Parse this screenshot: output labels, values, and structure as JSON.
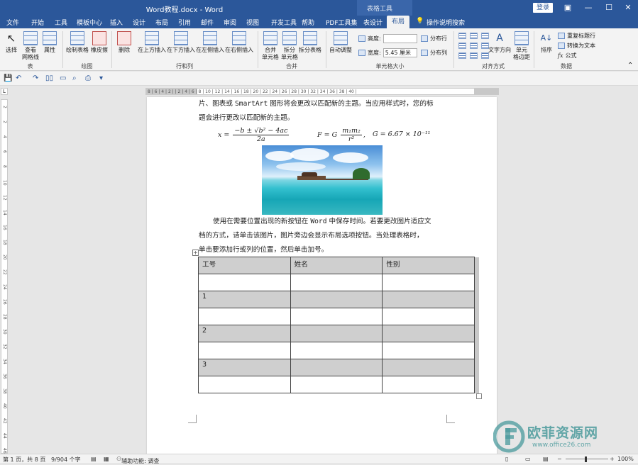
{
  "titlebar": {
    "doc_title": "Word教程.docx - Word",
    "context_label": "表格工具",
    "login": "登录"
  },
  "tabs": [
    "文件",
    "开始",
    "工具",
    "模板中心",
    "插入",
    "设计",
    "布局",
    "引用",
    "邮件",
    "审阅",
    "视图",
    "开发工具",
    "帮助",
    "PDF工具集",
    "表设计",
    "布局"
  ],
  "tell_me": "操作说明搜索",
  "ribbon": {
    "groups": {
      "table": "表",
      "draw": "绘图",
      "rows_cols": "行和列",
      "merge": "合并",
      "cell_size": "单元格大小",
      "alignment": "对齐方式",
      "data": "数据"
    },
    "buttons": {
      "select": "选择",
      "view_gridlines": "查看\n网格线",
      "properties": "属性",
      "draw_table": "绘制表格",
      "eraser": "橡皮擦",
      "delete": "删除",
      "insert_above": "在上方插入",
      "insert_below": "在下方插入",
      "insert_left": "在左侧插入",
      "insert_right": "在右侧插入",
      "merge_cells": "合并\n单元格",
      "split_cells": "拆分\n单元格",
      "split_table": "拆分表格",
      "autofit": "自动调整",
      "height_label": "高度:",
      "height_value": "",
      "width_label": "宽度:",
      "width_value": "5.45 厘米",
      "distribute_rows": "分布行",
      "distribute_cols": "分布列",
      "text_direction": "文字方向",
      "cell_margins": "单元\n格边距",
      "sort": "排序",
      "repeat_header": "重复标题行",
      "convert_text": "转换为文本",
      "formula": "公式"
    }
  },
  "ruler": {
    "horizontal": "8 | 6 | 4 | 2 |   | 2 | 4 | 6 | 8 | 10 | 12 | 14 | 16 | 18 | 20 | 22 | 24 | 26 | 28 | 30 | 32 | 34 | 36 | 38 | 40 |",
    "vertical": [
      "2",
      "2",
      "4",
      "6",
      "8",
      "10",
      "12",
      "14",
      "16",
      "18",
      "20",
      "22",
      "24",
      "26",
      "28",
      "30",
      "32",
      "34",
      "36",
      "38",
      "40",
      "42",
      "44",
      "46"
    ]
  },
  "document": {
    "para1_line1_a": "片、图表或 ",
    "para1_line1_mono": "SmartArt",
    "para1_line1_b": " 图形将会更改以匹配新的主题。当应用样式时，您的标",
    "para1_line2": "题会进行更改以匹配新的主题。",
    "formula": {
      "f1_lhs": "x =",
      "f1_num": "−b ± √b² − 4ac",
      "f1_den": "2a",
      "f2_lhs": "F = G",
      "f2_num": "m₁m₂",
      "f2_den": "r²",
      "f2_comma": ",",
      "f3": "G = 6.67 × 10⁻¹¹"
    },
    "para2_line1_a": "使用在需要位置出现的新按钮在 ",
    "para2_line1_mono": "Word",
    "para2_line1_b": " 中保存时间。若要更改图片适应文",
    "para2_line2": "档的方式，请单击该图片，图片旁边会显示布局选项按钮。当处理表格时，",
    "para2_line3": "单击要添加行或列的位置，然后单击加号。",
    "table": {
      "headers": [
        "工号",
        "姓名",
        "性别"
      ],
      "rows": [
        "1",
        "2",
        "3"
      ]
    }
  },
  "status": {
    "page": "第 1 页，共 8 页",
    "words": "9/904 个字",
    "accessibility": "辅助功能: 调查",
    "zoom": "100%"
  },
  "watermark": {
    "text": "欧菲资源网",
    "url": "www.office26.com"
  },
  "colors": {
    "accent": "#2b579a",
    "table_shade": "#cfcfcf",
    "watermark": "#4a9a9c"
  }
}
